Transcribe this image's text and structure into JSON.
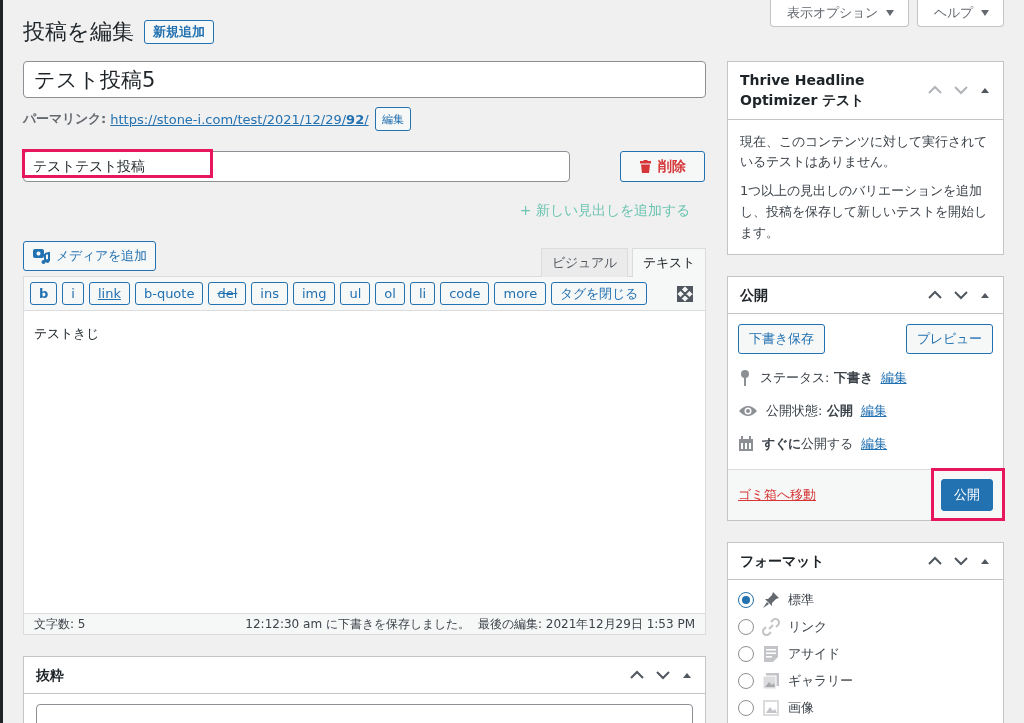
{
  "top_buttons": [
    {
      "label": "表示オプション"
    },
    {
      "label": "ヘルプ"
    }
  ],
  "page_title": "投稿を編集",
  "add_new_button": "新規追加",
  "post_title": {
    "value": "テスト投稿5"
  },
  "permalink": {
    "label": "パーマリンク:",
    "url": "https://stone-i.com/test/2021/12/29/**92**/",
    "edit_button": "編集"
  },
  "headline_variation": {
    "value": "テストテスト投稿",
    "highlighted": true,
    "delete_button": "削除"
  },
  "add_headline_link": "+ 新しい見出しを追加する",
  "editor": {
    "add_media_button": "メディアを追加",
    "tabs": [
      {
        "label": "ビジュアル",
        "selected": false
      },
      {
        "label": "テキスト",
        "selected": true
      }
    ],
    "quicktags": [
      {
        "label": "b",
        "kind": "bold"
      },
      {
        "label": "i",
        "kind": "plain"
      },
      {
        "label": "link",
        "kind": "underline"
      },
      {
        "label": "b-quote",
        "kind": "plain"
      },
      {
        "label": "del",
        "kind": "strike"
      },
      {
        "label": "ins",
        "kind": "plain"
      },
      {
        "label": "img",
        "kind": "plain"
      },
      {
        "label": "ul",
        "kind": "plain"
      },
      {
        "label": "ol",
        "kind": "plain"
      },
      {
        "label": "li",
        "kind": "plain"
      },
      {
        "label": "code",
        "kind": "plain"
      },
      {
        "label": "more",
        "kind": "plain"
      },
      {
        "label": "タグを閉じる",
        "kind": "plain"
      }
    ],
    "content": "テストきじ",
    "word_count": "文字数: 5",
    "save_status": "12:12:30 am に下書きを保存しました。",
    "last_edit": "最後の編集: 2021年12月29日 1:53 PM"
  },
  "excerpt_box": {
    "title": "抜粋"
  },
  "thrive_box": {
    "title": "Thrive Headline Optimizer テスト",
    "paragraphs": [
      "現在、このコンテンツに対して実行されているテストはありません。",
      "1つ以上の見出しのバリエーションを追加し、投稿を保存して新しいテストを開始します。"
    ]
  },
  "publish_box": {
    "title": "公開",
    "save_draft_button": "下書き保存",
    "preview_button": "プレビュー",
    "rows": [
      {
        "kind": "status",
        "text": "ステータス: **下書き**",
        "edit_link": "編集"
      },
      {
        "kind": "visibility",
        "text": "公開状態: **公開**",
        "edit_link": "編集"
      },
      {
        "kind": "schedule",
        "text": "**すぐに**公開する",
        "edit_link": "編集"
      }
    ],
    "trash_link": "ゴミ箱へ移動",
    "publish_button": "公開",
    "publish_highlighted": true
  },
  "format_box": {
    "title": "フォーマット",
    "options": [
      {
        "label": "標準",
        "kind": "standard",
        "selected": true
      },
      {
        "label": "リンク",
        "kind": "link",
        "selected": false
      },
      {
        "label": "アサイド",
        "kind": "aside",
        "selected": false
      },
      {
        "label": "ギャラリー",
        "kind": "gallery",
        "selected": false
      },
      {
        "label": "画像",
        "kind": "image",
        "selected": false
      }
    ]
  }
}
